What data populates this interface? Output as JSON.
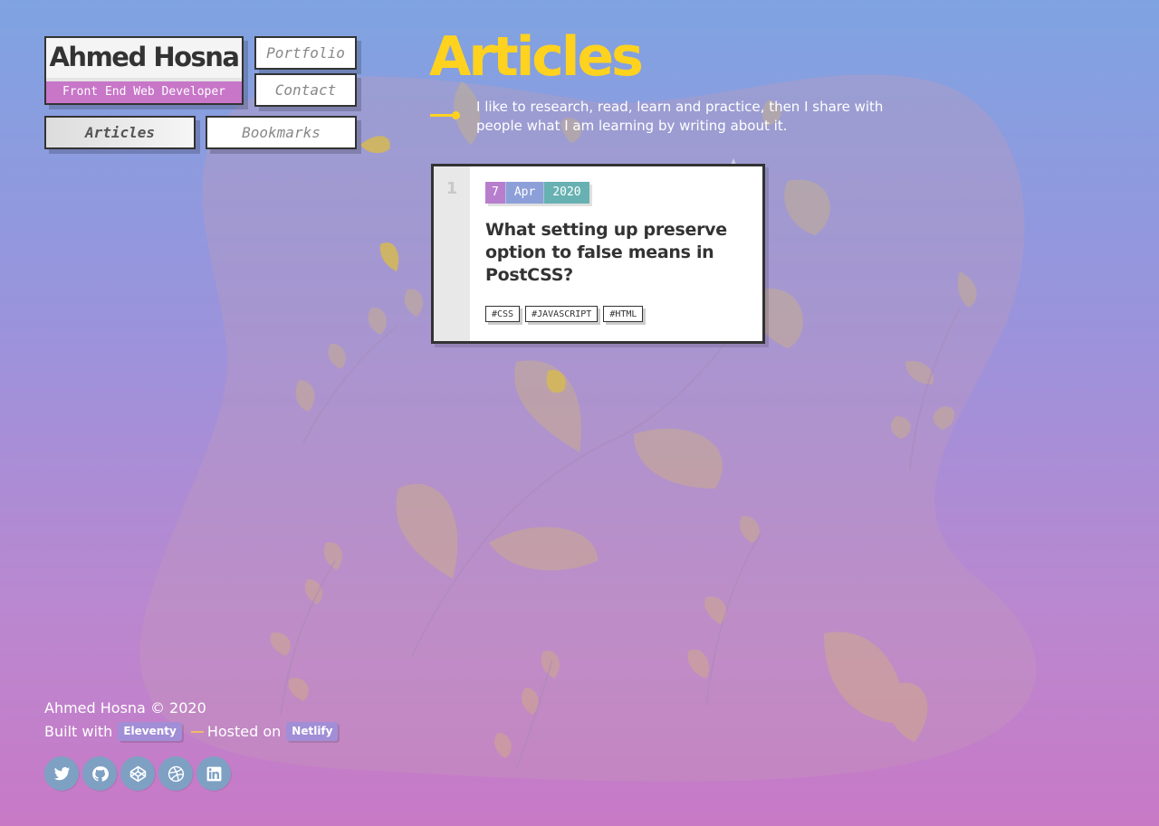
{
  "brand": {
    "name": "Ahmed Hosna",
    "role": "Front End Web Developer"
  },
  "nav": {
    "portfolio": "Portfolio",
    "contact": "Contact",
    "articles": "Articles",
    "bookmarks": "Bookmarks",
    "active": "Articles"
  },
  "page": {
    "title": "Articles",
    "intro": "I like to research, read, learn and practice, then I share with people what I am learning by writing about it."
  },
  "articles": [
    {
      "number": "1",
      "date": {
        "day": "7",
        "month": "Apr",
        "year": "2020"
      },
      "title": "What setting up preserve option to false means in PostCSS?",
      "tags": [
        "#CSS",
        "#JAVASCRIPT",
        "#HTML"
      ]
    }
  ],
  "footer": {
    "copyright": "Ahmed Hosna © 2020",
    "built_with": "Built with",
    "eleventy": "Eleventy",
    "hosted_on": "Hosted on",
    "netlify": "Netlify"
  },
  "socials": [
    "twitter-icon",
    "github-icon",
    "codepen-icon",
    "dribbble-icon",
    "linkedin-icon"
  ],
  "colors": {
    "accent_yellow": "#ffd21f",
    "role_bar": "#c876c8",
    "date_day": "#b77ecd",
    "date_month": "#8c9fd8",
    "date_year": "#68b1b2",
    "social_bg": "#7ea0c3"
  }
}
